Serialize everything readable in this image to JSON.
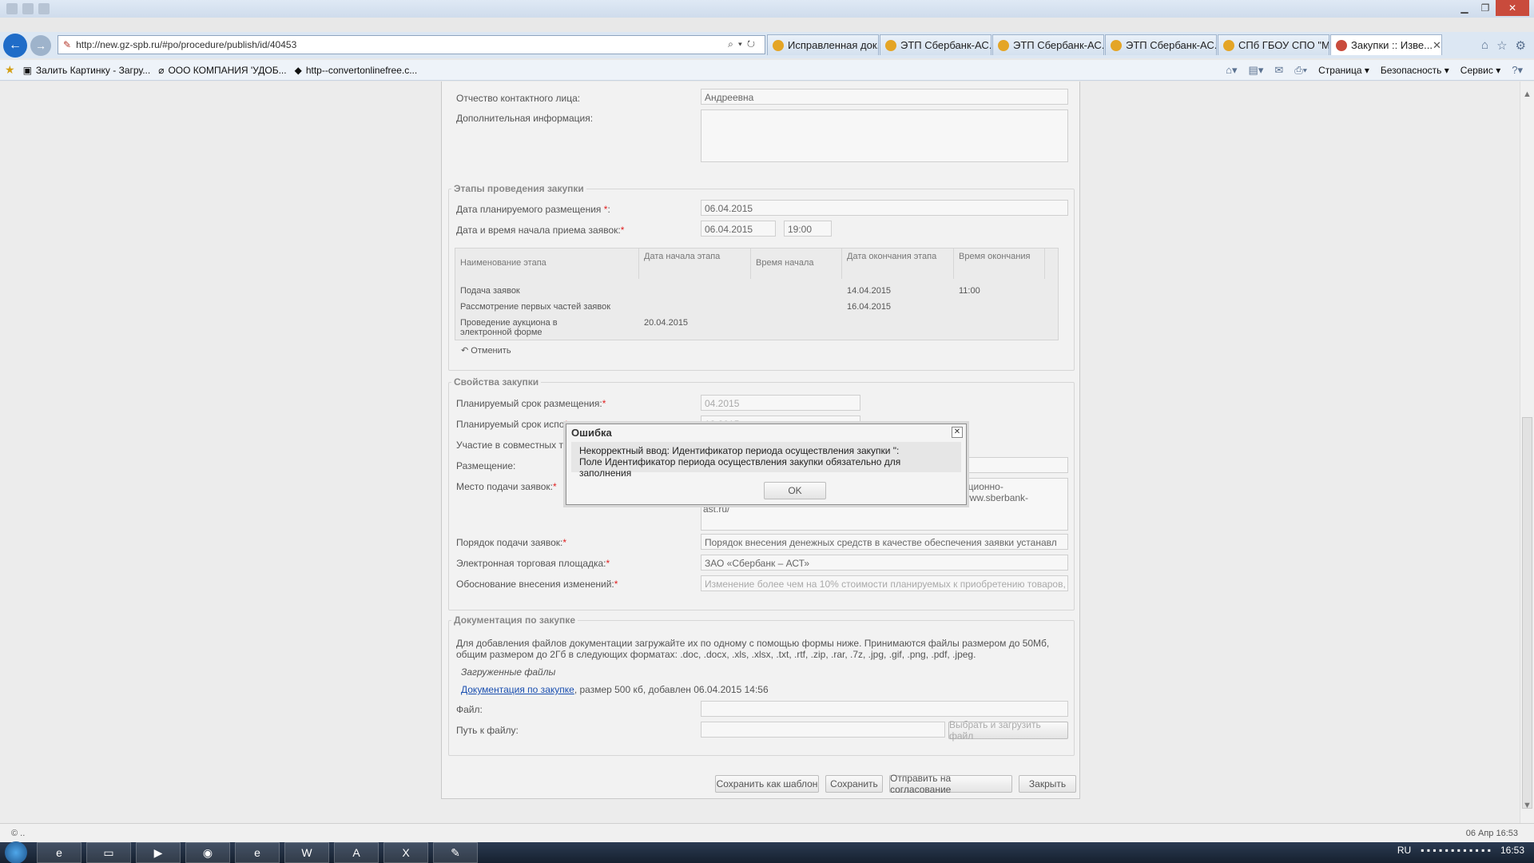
{
  "browser": {
    "address": "http://new.gz-spb.ru/#po/procedure/publish/id/40453",
    "tabs": [
      {
        "label": "Исправленная док..."
      },
      {
        "label": "ЭТП Сбербанк-АС..."
      },
      {
        "label": "ЭТП Сбербанк-АС..."
      },
      {
        "label": "ЭТП Сбербанк-АС..."
      },
      {
        "label": "СПб ГБОУ СПО \"М..."
      },
      {
        "label": "Закупки :: Изве..."
      }
    ],
    "favorites": [
      {
        "label": "Залить Картинку - Загру..."
      },
      {
        "label": "ООО КОМПАНИЯ 'УДОБ..."
      },
      {
        "label": "http--convertonlinefree.c..."
      }
    ],
    "commands": {
      "page": "Страница",
      "security": "Безопасность",
      "service": "Сервис"
    }
  },
  "form": {
    "contact_patronymic_label": "Отчество контактного лица:",
    "contact_patronymic_value": "Андреевна",
    "additional_info_label": "Дополнительная информация:",
    "stages": {
      "legend": "Этапы проведения закупки",
      "planned_date_label": "Дата планируемого размещения",
      "planned_date_value": "06.04.2015",
      "start_datetime_label": "Дата и время начала приема заявок:",
      "start_date_value": "06.04.2015",
      "start_time_value": "19:00",
      "columns": [
        "Наименование этапа",
        "Дата начала этапа",
        "Время начала",
        "Дата окончания этапа",
        "Время окончания"
      ],
      "rows": [
        {
          "name": "Подача заявок",
          "start_date": "",
          "start_time": "",
          "end_date": "14.04.2015",
          "end_time": "11:00"
        },
        {
          "name": "Рассмотрение первых частей заявок",
          "start_date": "",
          "start_time": "",
          "end_date": "16.04.2015",
          "end_time": ""
        },
        {
          "name": "Проведение аукциона в электронной форме",
          "start_date": "20.04.2015",
          "start_time": "",
          "end_date": "",
          "end_time": ""
        }
      ],
      "cancel_label": "Отменить"
    },
    "properties": {
      "legend": "Свойства закупки",
      "planned_term_label": "Планируемый срок размещения:",
      "planned_term_value": "04.2015",
      "exec_term_label": "Планируемый срок испо",
      "exec_term_value": "12.2015",
      "joint_label": "Участие в совместных то",
      "placement_label": "Размещение:",
      "submit_place_label": "Место подачи заявок:",
      "submit_place_value": "ационно- www.sberbank-",
      "submit_place_value2": "ast.ru/",
      "submit_order_label": "Порядок подачи заявок:",
      "submit_order_value": "Порядок внесения денежных средств в качестве обеспечения заявки устанавл",
      "etp_label": "Электронная торговая площадка:",
      "etp_value": "ЗАО «Сбербанк – АСТ»",
      "reason_label": "Обоснование внесения изменений:",
      "reason_value": "Изменение более чем на 10% стоимости планируемых к приобретению товаров,"
    },
    "docs": {
      "legend": "Документация по закупке",
      "hint": "Для добавления файлов документации загружайте их по одному с помощью формы ниже. Принимаются файлы размером до 50Мб, общим размером до 2Гб в следующих форматах: .doc, .docx, .xls, .xlsx, .txt, .rtf, .zip, .rar, .7z, .jpg, .gif, .png, .pdf, .jpeg.",
      "uploaded_label": "Загруженные файлы",
      "file_link": "Документация по закупке",
      "file_meta": ", размер 500 кб, добавлен 06.04.2015 14:56",
      "file_label": "Файл:",
      "path_label": "Путь к файлу:",
      "upload_button": "Выбрать и загрузить файл"
    },
    "actions": {
      "save_template": "Сохранить как шаблон",
      "save": "Сохранить",
      "send": "Отправить на согласование",
      "close": "Закрыть"
    }
  },
  "dialog": {
    "title": "Ошибка",
    "line1": "Некорректный ввод: Идентификатор периода осуществления закупки \":",
    "line2": "Поле Идентификатор периода осуществления закупки обязательно для заполнения",
    "ok": "OK"
  },
  "status": {
    "left": "© ..",
    "right": "06 Апр 16:53"
  },
  "taskbar": {
    "lang": "RU",
    "clock": "16:53"
  }
}
